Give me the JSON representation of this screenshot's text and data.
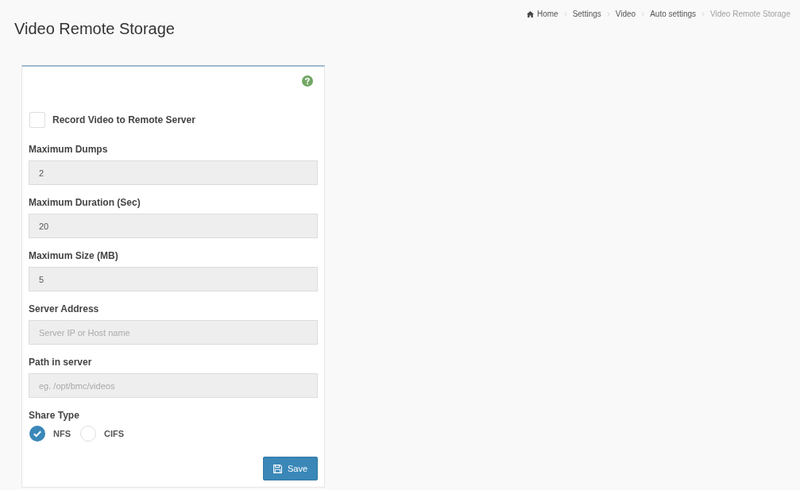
{
  "page": {
    "title": "Video Remote Storage"
  },
  "breadcrumb": [
    {
      "label": "Home",
      "active": false
    },
    {
      "label": "Settings",
      "active": false
    },
    {
      "label": "Video",
      "active": false
    },
    {
      "label": "Auto settings",
      "active": false
    },
    {
      "label": "Video Remote Storage",
      "active": true
    }
  ],
  "form": {
    "record_to_remote": {
      "label": "Record Video to Remote Server",
      "checked": false
    },
    "fields": [
      {
        "label": "Maximum Dumps",
        "value": "2",
        "disabled": true
      },
      {
        "label": "Maximum Duration (Sec)",
        "value": "20",
        "disabled": true
      },
      {
        "label": "Maximum Size (MB)",
        "value": "5",
        "disabled": true
      },
      {
        "label": "Server Address",
        "placeholder": "Server IP or Host name",
        "disabled": true
      },
      {
        "label": "Path in server",
        "placeholder": "eg. /opt/bmc/videos",
        "disabled": true
      }
    ],
    "share_type": {
      "label": "Share Type",
      "options": [
        {
          "label": "NFS",
          "selected": true
        },
        {
          "label": "CIFS",
          "selected": false
        }
      ]
    },
    "save_button": {
      "label": "Save"
    }
  }
}
